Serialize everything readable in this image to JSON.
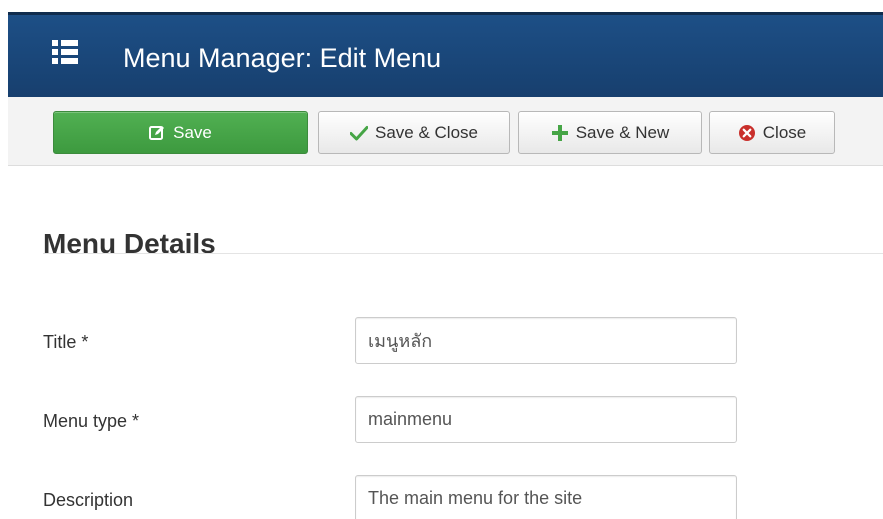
{
  "header": {
    "title": "Menu Manager: Edit Menu",
    "icon": "list-icon"
  },
  "toolbar": {
    "buttons": [
      {
        "label": "Save",
        "icon": "edit-icon",
        "style": "primary"
      },
      {
        "label": "Save & Close",
        "icon": "check-icon",
        "style": "default"
      },
      {
        "label": "Save & New",
        "icon": "plus-icon",
        "style": "default"
      },
      {
        "label": "Close",
        "icon": "close-circle-icon",
        "style": "default"
      }
    ]
  },
  "main": {
    "section_title": "Menu Details",
    "fields": [
      {
        "label": "Title *",
        "value": "เมนูหลัก",
        "placeholder": ""
      },
      {
        "label": "Menu type *",
        "value": "mainmenu",
        "placeholder": ""
      },
      {
        "label": "Description",
        "value": "The main menu for the site",
        "placeholder": ""
      }
    ]
  },
  "colors": {
    "header_bg": "#1d4f86",
    "save_button_bg": "#46a546",
    "close_icon": "#c9302c",
    "check_icon": "#46a546",
    "plus_icon": "#46a546"
  }
}
